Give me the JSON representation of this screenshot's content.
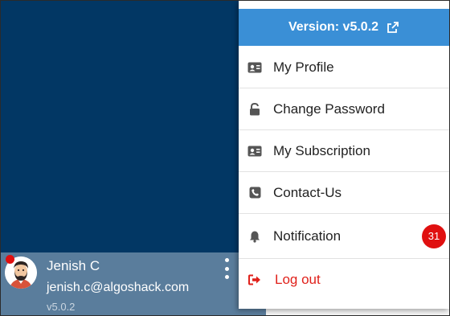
{
  "user": {
    "name": "Jenish C",
    "email": "jenish.c@algoshack.com",
    "version": "v5.0.2"
  },
  "menu": {
    "header_label": "Version: v5.0.2",
    "items": [
      {
        "label": "My Profile",
        "icon": "id-card-icon"
      },
      {
        "label": "Change Password",
        "icon": "lock-open-icon"
      },
      {
        "label": "My Subscription",
        "icon": "id-badge-icon"
      },
      {
        "label": "Contact-Us",
        "icon": "phone-icon"
      },
      {
        "label": "Notification",
        "icon": "bell-icon",
        "badge": "31"
      },
      {
        "label": "Log out",
        "icon": "sign-out-icon"
      }
    ]
  },
  "colors": {
    "sidebar": "#023764",
    "user_panel": "#5a7d9c",
    "header": "#3a8fd6",
    "badge": "#e01010",
    "logout": "#e0211b"
  }
}
